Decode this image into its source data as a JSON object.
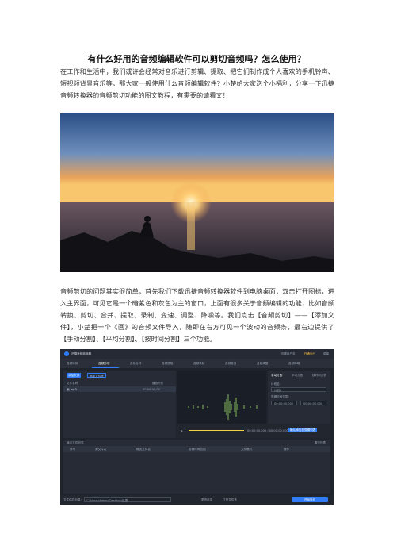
{
  "title": "有什么好用的音频编辑软件可以剪切音频吗？怎么使用？",
  "paragraph1": "在工作和生活中，我们或许会经常对音乐进行剪辑、提取、把它们制作成个人喜欢的手机铃声、短视频背景音乐等，那大家一般使用什么音频编辑软件？小楚给大家送个小福利，分享一下迅捷音频转换器的音频剪切功能的图文教程，有需要的请看文！",
  "paragraph2": "音频剪切的问题其实很简单，首先我们下载迅捷音频转换器软件到电脑桌面，双击打开图标，进入主界面，可见它是一个暗紫色和灰色为主的窗口，上面有很多关于音频编辑的功能，比如音频转换、剪切、合并、提取、录制、变速、调整、降噪等。我们点击【音频剪切】——【添加文件】，小楚把一个《画》的音频文件导入，随即在右方可见一个波动的音频条，最右边提供了【手动分割】、【平均分割】、【按时间分割】三个功能。",
  "screenshot": {
    "app_title": "迅捷音频转换器",
    "user": "迅捷用户名",
    "vip": "开通VIP",
    "menu": "菜单",
    "tabs": [
      "音频转换",
      "音频剪切",
      "音频合并",
      "音频提取",
      "音频录制",
      "音频变速",
      "音量调整",
      "音频降噪"
    ],
    "active_tab_index": 1,
    "add_file": "添加文件",
    "add_folder": "添加文件夹",
    "col_file_name": "文件名称",
    "col_duration": "播放时长",
    "file_row_name": "画.mp3",
    "file_row_time": "00:00:00.00",
    "right_tabs": [
      "手动分割",
      "平均分割",
      "按时间分割"
    ],
    "segment_label": "片段名：",
    "segment_placeholder": "片段1",
    "time_label": "剪辑时间范围：",
    "time_start": "00:00:00.000",
    "time_end": "00:00:00.000",
    "playback": "00:00:00.000 / 00:00:00.000",
    "add_to_list": "确认添加到剪辑列表",
    "list_title": "输出文件列表",
    "clear_list": "清空列表",
    "list_cols": [
      "序号",
      "源文件名",
      "输出文件名",
      "剪辑时间范围",
      "文件格式",
      "操作"
    ],
    "output_label": "文件保存目录：",
    "output_path": "C:\\Users\\Admin\\Desktop\\迅捷",
    "change_dir": "更改目录",
    "open_folder": "打开文件夹",
    "start": "开始剪切"
  }
}
